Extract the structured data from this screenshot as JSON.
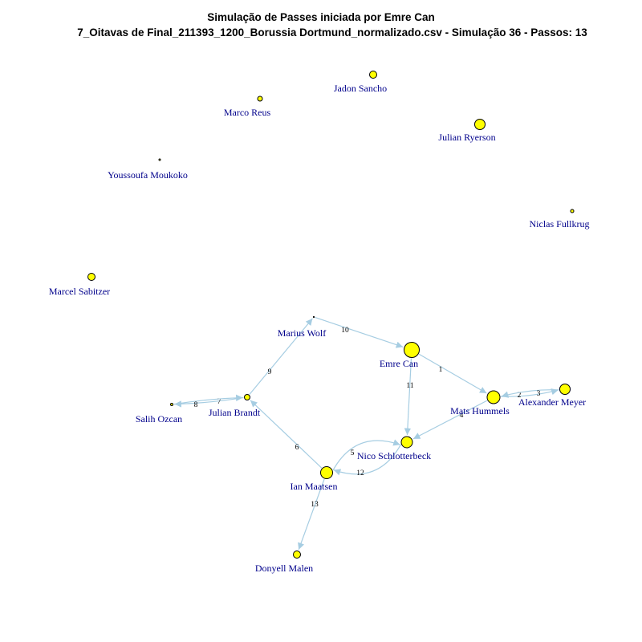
{
  "title": {
    "line1": "Simulação de Passes iniciada por Emre Can",
    "line2": "7_Oitavas de Final_211393_1200_Borussia Dortmund_normalizado.csv - Simulação 36 - Passos: 13"
  },
  "colors": {
    "node_fill": "#ffff00",
    "node_stroke": "#000000",
    "edge": "#a6cde2",
    "label": "#00008b"
  },
  "nodes": [
    {
      "id": "sancho",
      "label": "Jadon Sancho"
    },
    {
      "id": "reus",
      "label": "Marco Reus"
    },
    {
      "id": "ryerson",
      "label": "Julian Ryerson"
    },
    {
      "id": "moukoko",
      "label": "Youssoufa Moukoko"
    },
    {
      "id": "fullkrug",
      "label": "Niclas Fullkrug"
    },
    {
      "id": "sabitzer",
      "label": "Marcel Sabitzer"
    },
    {
      "id": "wolf",
      "label": "Marius Wolf"
    },
    {
      "id": "emre",
      "label": "Emre Can"
    },
    {
      "id": "hummels",
      "label": "Mats Hummels"
    },
    {
      "id": "meyer",
      "label": "Alexander Meyer"
    },
    {
      "id": "brandt",
      "label": "Julian Brandt"
    },
    {
      "id": "ozcan",
      "label": "Salih Ozcan"
    },
    {
      "id": "schlotterbeck",
      "label": "Nico Schlotterbeck"
    },
    {
      "id": "maatsen",
      "label": "Ian Maatsen"
    },
    {
      "id": "malen",
      "label": "Donyell Malen"
    }
  ],
  "edges": [
    {
      "from": "emre",
      "to": "hummels",
      "label": "1"
    },
    {
      "from": "hummels",
      "to": "meyer",
      "label": "2"
    },
    {
      "from": "meyer",
      "to": "hummels",
      "label": "3"
    },
    {
      "from": "hummels",
      "to": "schlotterbeck",
      "label": "4"
    },
    {
      "from": "schlotterbeck",
      "to": "maatsen",
      "label": "5"
    },
    {
      "from": "maatsen",
      "to": "brandt",
      "label": "6"
    },
    {
      "from": "brandt",
      "to": "ozcan",
      "label": "7"
    },
    {
      "from": "ozcan",
      "to": "brandt",
      "label": "8"
    },
    {
      "from": "brandt",
      "to": "wolf",
      "label": "9"
    },
    {
      "from": "wolf",
      "to": "emre",
      "label": "10"
    },
    {
      "from": "emre",
      "to": "schlotterbeck",
      "label": "11"
    },
    {
      "from": "maatsen",
      "to": "schlotterbeck",
      "label": "12"
    },
    {
      "from": "maatsen",
      "to": "malen",
      "label": "13"
    }
  ]
}
